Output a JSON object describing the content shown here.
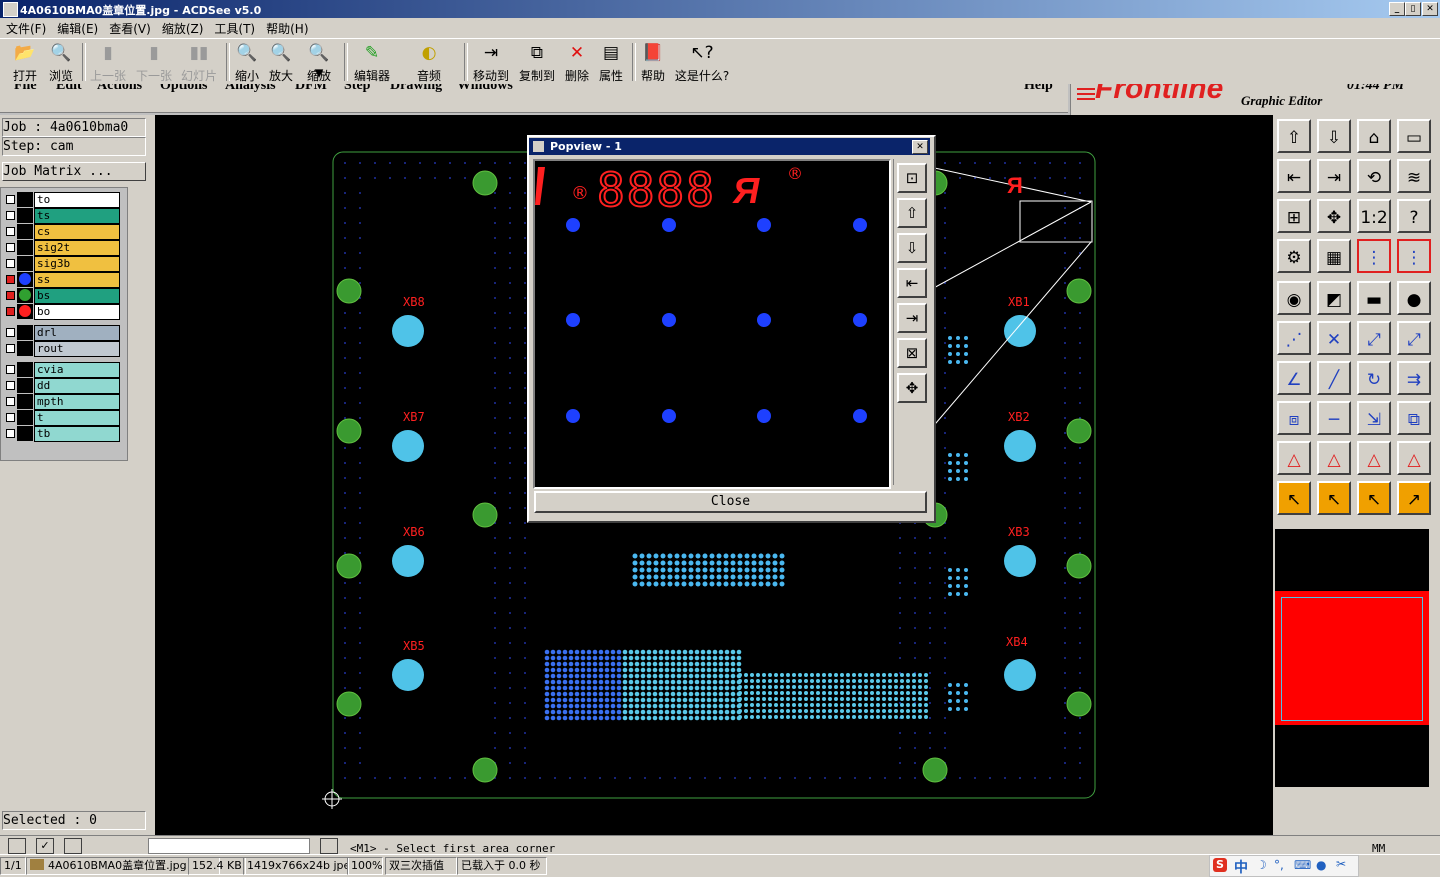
{
  "window": {
    "title": "4A0610BMA0盖章位置.jpg - ACDSee v5.0",
    "min": "_",
    "max": "▯",
    "close": "✕"
  },
  "menu": [
    "文件(F)",
    "编辑(E)",
    "查看(V)",
    "缩放(Z)",
    "工具(T)",
    "帮助(H)"
  ],
  "toolbar": {
    "open": "打开",
    "browse": "浏览",
    "prev": "上一张",
    "next": "下一张",
    "slideshow": "幻灯片",
    "zoom_out": "缩小",
    "zoom_in": "放大",
    "zoom": "缩放",
    "editor": "编辑器",
    "audio": "音频",
    "move_to": "移动到",
    "copy_to": "复制到",
    "delete": "删除",
    "properties": "属性",
    "help": "帮助",
    "whats_this": "这是什么?"
  },
  "frontline": {
    "menu": [
      "File",
      "Edit",
      "Actions",
      "Options",
      "Analysis",
      "DFM",
      "Step",
      "Drawing",
      "Windows"
    ],
    "help": "Help",
    "brand": "Frontline",
    "subtitle": "Graphic Editor",
    "clock": "01:44 PM",
    "job": "Job : 4a0610bma0",
    "step": "Step: cam",
    "job_matrix": "Job Matrix ...",
    "selected": "Selected : 0",
    "prompt": "<M1> - Select first area corner",
    "units": "MM",
    "layers": [
      {
        "name": "to",
        "color": "#ffffff",
        "marked": false,
        "dot": ""
      },
      {
        "name": "ts",
        "color": "#20a080",
        "marked": false,
        "dot": ""
      },
      {
        "name": "cs",
        "color": "#f0c040",
        "marked": false,
        "dot": ""
      },
      {
        "name": "sig2t",
        "color": "#f0c040",
        "marked": false,
        "dot": ""
      },
      {
        "name": "sig3b",
        "color": "#f0c040",
        "marked": false,
        "dot": ""
      },
      {
        "name": "ss",
        "color": "#f0c040",
        "marked": true,
        "dot": "#1e40ff"
      },
      {
        "name": "bs",
        "color": "#20a080",
        "marked": true,
        "dot": "#30a030"
      },
      {
        "name": "bo",
        "color": "#ffffff",
        "marked": true,
        "dot": "#ff2020"
      },
      {
        "name": "drl",
        "color": "#a0b0c0",
        "marked": false,
        "dot": ""
      },
      {
        "name": "rout",
        "color": "#c0c8d0",
        "marked": false,
        "dot": ""
      },
      {
        "name": "cvia",
        "color": "#90d8d0",
        "marked": false,
        "dot": ""
      },
      {
        "name": "dd",
        "color": "#90d8d0",
        "marked": false,
        "dot": ""
      },
      {
        "name": "mpth",
        "color": "#90d8d0",
        "marked": false,
        "dot": ""
      },
      {
        "name": "t",
        "color": "#90d8d0",
        "marked": false,
        "dot": ""
      },
      {
        "name": "tb",
        "color": "#90d8d0",
        "marked": false,
        "dot": ""
      }
    ],
    "board_labels": [
      "XB8",
      "XB7",
      "XB6",
      "XB5",
      "XB1",
      "XB2",
      "XB3",
      "XB4"
    ],
    "popview": {
      "title": "Popview - 1",
      "close": "Close",
      "digits": "8888"
    }
  },
  "status": {
    "index": "1/1",
    "file": "4A0610BMA0盖章位置.jpg",
    "size": "152.4 KB",
    "dims": "1419x766x24b jpeg",
    "zoom": "100%",
    "mode": "双三次插值",
    "loaded": "已载入于 0.0 秒"
  },
  "ime": {
    "label": "中"
  }
}
